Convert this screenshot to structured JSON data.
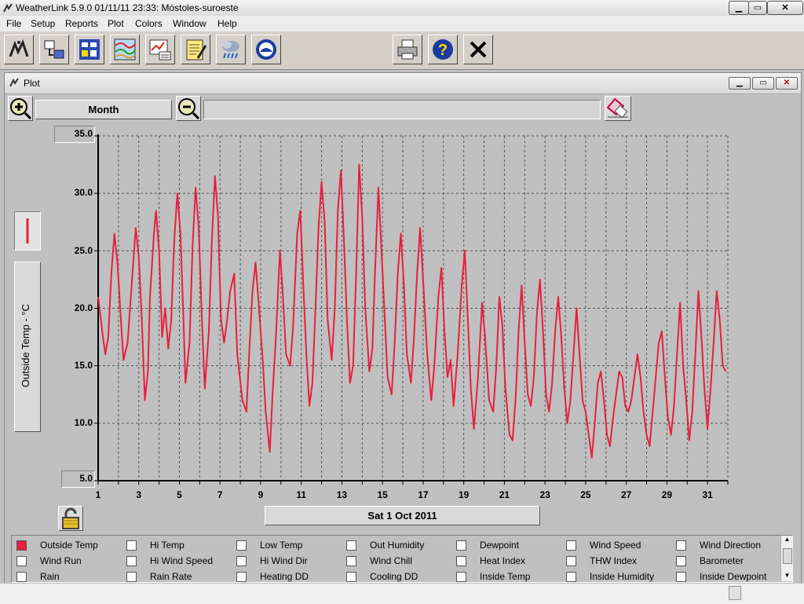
{
  "window": {
    "title": "WeatherLink 5.9.0  01/11/11  23:33: Móstoles-suroeste"
  },
  "menu": [
    "File",
    "Setup",
    "Reports",
    "Plot",
    "Colors",
    "Window",
    "Help"
  ],
  "toolbar": {
    "left_icons": [
      "station-icon",
      "download-icon",
      "bulletin-icon",
      "strip-chart-icon",
      "browse-icon",
      "notes-icon",
      "weather-icon",
      "noaa-icon"
    ],
    "right_icons": [
      "print-icon",
      "help-icon",
      "close-icon"
    ]
  },
  "plot_window": {
    "title": "Plot"
  },
  "controls": {
    "span_label": "Month",
    "date_label": "Sat 1 Oct 2011",
    "range_text": ""
  },
  "axis": {
    "y_label": "Outside Temp - °C"
  },
  "colors": {
    "series": "#e8203c",
    "grid": "#555555"
  },
  "chart_data": {
    "type": "line",
    "title": "",
    "xlabel": "",
    "ylabel": "Outside Temp - °C",
    "xlim": [
      1,
      32.0
    ],
    "ylim": [
      5.0,
      35.0
    ],
    "y_ticks": [
      "35.0",
      "30.0",
      "25.0",
      "20.0",
      "15.0",
      "10.0",
      "5.0"
    ],
    "x_ticks": [
      "1",
      "3",
      "5",
      "7",
      "9",
      "11",
      "13",
      "15",
      "17",
      "19",
      "21",
      "23",
      "25",
      "27",
      "29",
      "31"
    ],
    "grid": true,
    "series": [
      {
        "name": "Outside Temp",
        "points": [
          [
            1.0,
            21.0
          ],
          [
            1.2,
            18.0
          ],
          [
            1.35,
            16.0
          ],
          [
            1.5,
            17.5
          ],
          [
            1.65,
            23.0
          ],
          [
            1.8,
            26.5
          ],
          [
            1.95,
            24.0
          ],
          [
            2.1,
            19.5
          ],
          [
            2.25,
            15.5
          ],
          [
            2.45,
            17.0
          ],
          [
            2.65,
            22.0
          ],
          [
            2.85,
            27.0
          ],
          [
            3.0,
            24.5
          ],
          [
            3.15,
            19.0
          ],
          [
            3.3,
            12.0
          ],
          [
            3.45,
            14.5
          ],
          [
            3.55,
            21.0
          ],
          [
            3.75,
            26.5
          ],
          [
            3.85,
            28.5
          ],
          [
            4.0,
            25.0
          ],
          [
            4.15,
            17.5
          ],
          [
            4.3,
            20.0
          ],
          [
            4.45,
            16.5
          ],
          [
            4.6,
            19.0
          ],
          [
            4.75,
            26.0
          ],
          [
            4.9,
            30.0
          ],
          [
            5.05,
            26.5
          ],
          [
            5.2,
            19.0
          ],
          [
            5.3,
            13.5
          ],
          [
            5.5,
            17.0
          ],
          [
            5.65,
            25.5
          ],
          [
            5.8,
            30.5
          ],
          [
            5.95,
            27.0
          ],
          [
            6.1,
            19.5
          ],
          [
            6.25,
            13.0
          ],
          [
            6.45,
            18.0
          ],
          [
            6.6,
            26.0
          ],
          [
            6.75,
            31.5
          ],
          [
            6.9,
            28.0
          ],
          [
            7.05,
            19.0
          ],
          [
            7.2,
            17.0
          ],
          [
            7.35,
            19.0
          ],
          [
            7.5,
            21.5
          ],
          [
            7.7,
            23.0
          ],
          [
            7.85,
            16.0
          ],
          [
            8.1,
            12.0
          ],
          [
            8.3,
            11.0
          ],
          [
            8.45,
            16.5
          ],
          [
            8.6,
            21.5
          ],
          [
            8.75,
            24.0
          ],
          [
            8.9,
            20.5
          ],
          [
            9.1,
            15.5
          ],
          [
            9.25,
            11.0
          ],
          [
            9.45,
            7.5
          ],
          [
            9.6,
            13.0
          ],
          [
            9.75,
            17.5
          ],
          [
            9.95,
            25.0
          ],
          [
            10.1,
            21.0
          ],
          [
            10.25,
            16.0
          ],
          [
            10.45,
            15.0
          ],
          [
            10.6,
            18.5
          ],
          [
            10.8,
            26.5
          ],
          [
            10.95,
            28.5
          ],
          [
            11.1,
            22.0
          ],
          [
            11.25,
            16.0
          ],
          [
            11.4,
            11.5
          ],
          [
            11.55,
            13.5
          ],
          [
            11.7,
            20.0
          ],
          [
            11.85,
            27.0
          ],
          [
            12.0,
            31.0
          ],
          [
            12.15,
            27.5
          ],
          [
            12.3,
            19.0
          ],
          [
            12.5,
            15.5
          ],
          [
            12.65,
            20.0
          ],
          [
            12.8,
            28.5
          ],
          [
            12.95,
            32.0
          ],
          [
            13.1,
            26.0
          ],
          [
            13.25,
            19.0
          ],
          [
            13.4,
            13.5
          ],
          [
            13.55,
            15.0
          ],
          [
            13.7,
            23.0
          ],
          [
            13.85,
            32.5
          ],
          [
            14.0,
            28.0
          ],
          [
            14.15,
            20.0
          ],
          [
            14.35,
            14.5
          ],
          [
            14.5,
            16.5
          ],
          [
            14.65,
            24.0
          ],
          [
            14.8,
            30.5
          ],
          [
            14.95,
            25.0
          ],
          [
            15.1,
            19.5
          ],
          [
            15.25,
            14.0
          ],
          [
            15.45,
            12.5
          ],
          [
            15.6,
            17.0
          ],
          [
            15.75,
            23.0
          ],
          [
            15.9,
            26.5
          ],
          [
            16.05,
            22.0
          ],
          [
            16.2,
            16.0
          ],
          [
            16.4,
            13.5
          ],
          [
            16.55,
            17.5
          ],
          [
            16.7,
            23.0
          ],
          [
            16.85,
            27.0
          ],
          [
            17.0,
            22.5
          ],
          [
            17.2,
            16.0
          ],
          [
            17.4,
            12.0
          ],
          [
            17.55,
            15.0
          ],
          [
            17.75,
            21.0
          ],
          [
            17.9,
            23.5
          ],
          [
            18.05,
            18.0
          ],
          [
            18.2,
            14.0
          ],
          [
            18.35,
            15.5
          ],
          [
            18.5,
            11.5
          ],
          [
            18.7,
            16.0
          ],
          [
            18.9,
            22.0
          ],
          [
            19.05,
            25.0
          ],
          [
            19.2,
            19.0
          ],
          [
            19.35,
            13.0
          ],
          [
            19.5,
            9.5
          ],
          [
            19.7,
            14.0
          ],
          [
            19.9,
            20.5
          ],
          [
            20.05,
            17.5
          ],
          [
            20.25,
            12.0
          ],
          [
            20.45,
            11.0
          ],
          [
            20.6,
            15.0
          ],
          [
            20.75,
            21.0
          ],
          [
            20.9,
            18.5
          ],
          [
            21.05,
            13.0
          ],
          [
            21.25,
            9.0
          ],
          [
            21.4,
            8.5
          ],
          [
            21.55,
            12.0
          ],
          [
            21.7,
            18.0
          ],
          [
            21.85,
            22.0
          ],
          [
            22.0,
            17.0
          ],
          [
            22.15,
            12.5
          ],
          [
            22.3,
            11.5
          ],
          [
            22.45,
            14.0
          ],
          [
            22.6,
            19.5
          ],
          [
            22.75,
            22.5
          ],
          [
            22.9,
            18.0
          ],
          [
            23.05,
            12.5
          ],
          [
            23.2,
            11.0
          ],
          [
            23.35,
            13.5
          ],
          [
            23.5,
            18.0
          ],
          [
            23.65,
            21.0
          ],
          [
            23.8,
            17.5
          ],
          [
            23.95,
            13.0
          ],
          [
            24.1,
            10.0
          ],
          [
            24.25,
            12.0
          ],
          [
            24.4,
            16.0
          ],
          [
            24.55,
            20.0
          ],
          [
            24.7,
            16.0
          ],
          [
            24.85,
            12.0
          ],
          [
            25.0,
            11.0
          ],
          [
            25.15,
            9.0
          ],
          [
            25.3,
            7.0
          ],
          [
            25.45,
            10.0
          ],
          [
            25.6,
            13.5
          ],
          [
            25.75,
            14.5
          ],
          [
            25.9,
            12.0
          ],
          [
            26.05,
            9.0
          ],
          [
            26.2,
            8.0
          ],
          [
            26.35,
            10.5
          ],
          [
            26.5,
            12.5
          ],
          [
            26.65,
            14.5
          ],
          [
            26.8,
            14.0
          ],
          [
            26.95,
            11.5
          ],
          [
            27.1,
            11.0
          ],
          [
            27.25,
            12.0
          ],
          [
            27.4,
            14.0
          ],
          [
            27.55,
            16.0
          ],
          [
            27.7,
            14.0
          ],
          [
            27.85,
            11.0
          ],
          [
            28.0,
            9.0
          ],
          [
            28.15,
            8.0
          ],
          [
            28.3,
            11.0
          ],
          [
            28.45,
            14.0
          ],
          [
            28.6,
            17.0
          ],
          [
            28.75,
            18.0
          ],
          [
            28.9,
            14.0
          ],
          [
            29.05,
            10.5
          ],
          [
            29.2,
            9.0
          ],
          [
            29.35,
            11.5
          ],
          [
            29.5,
            16.0
          ],
          [
            29.65,
            20.5
          ],
          [
            29.8,
            15.0
          ],
          [
            29.95,
            12.0
          ],
          [
            30.1,
            8.5
          ],
          [
            30.25,
            11.0
          ],
          [
            30.4,
            16.0
          ],
          [
            30.55,
            21.5
          ],
          [
            30.7,
            17.5
          ],
          [
            30.85,
            13.0
          ],
          [
            31.0,
            9.5
          ],
          [
            31.15,
            13.0
          ],
          [
            31.3,
            17.0
          ],
          [
            31.45,
            21.5
          ],
          [
            31.6,
            19.0
          ],
          [
            31.75,
            15.0
          ],
          [
            31.9,
            14.5
          ]
        ]
      }
    ]
  },
  "legend": {
    "rows": [
      [
        "Outside Temp",
        "Hi Temp",
        "Low Temp",
        "Out Humidity",
        "Dewpoint",
        "Wind Speed",
        "Wind Direction"
      ],
      [
        "Wind Run",
        "Hi Wind Speed",
        "Hi Wind Dir",
        "Wind Chill",
        "Heat Index",
        "THW Index",
        "Barometer"
      ],
      [
        "Rain",
        "Rain Rate",
        "Heating DD",
        "Cooling DD",
        "Inside Temp",
        "Inside Humidity",
        "Inside Dewpoint"
      ]
    ],
    "checked": [
      "Outside Temp"
    ],
    "checked_color": "#e8203c"
  }
}
